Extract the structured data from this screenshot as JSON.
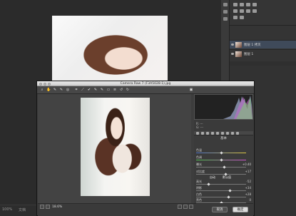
{
  "photoshop": {
    "status": {
      "zoom": "100%",
      "doc": "文档"
    },
    "layers": [
      {
        "name": "图层 1 拷贝"
      },
      {
        "name": "图层 1"
      }
    ]
  },
  "camera_raw": {
    "title": "Camera Raw 7 (F3A5028-1).jpg",
    "zoom_level": "18.6%",
    "buttons": {
      "cancel": "取消",
      "ok": "确定"
    },
    "panel": {
      "name": "基本",
      "auto": "自动",
      "default": "默认值",
      "sliders": [
        {
          "label": "色温",
          "value": ""
        },
        {
          "label": "色调",
          "value": ""
        },
        {
          "label": "曝光",
          "value": "+0.40"
        },
        {
          "label": "对比度",
          "value": "+17"
        },
        {
          "label": "高光",
          "value": "-52"
        },
        {
          "label": "阴影",
          "value": "+34"
        },
        {
          "label": "白色",
          "value": "+28"
        },
        {
          "label": "黑色",
          "value": "0"
        }
      ]
    }
  }
}
